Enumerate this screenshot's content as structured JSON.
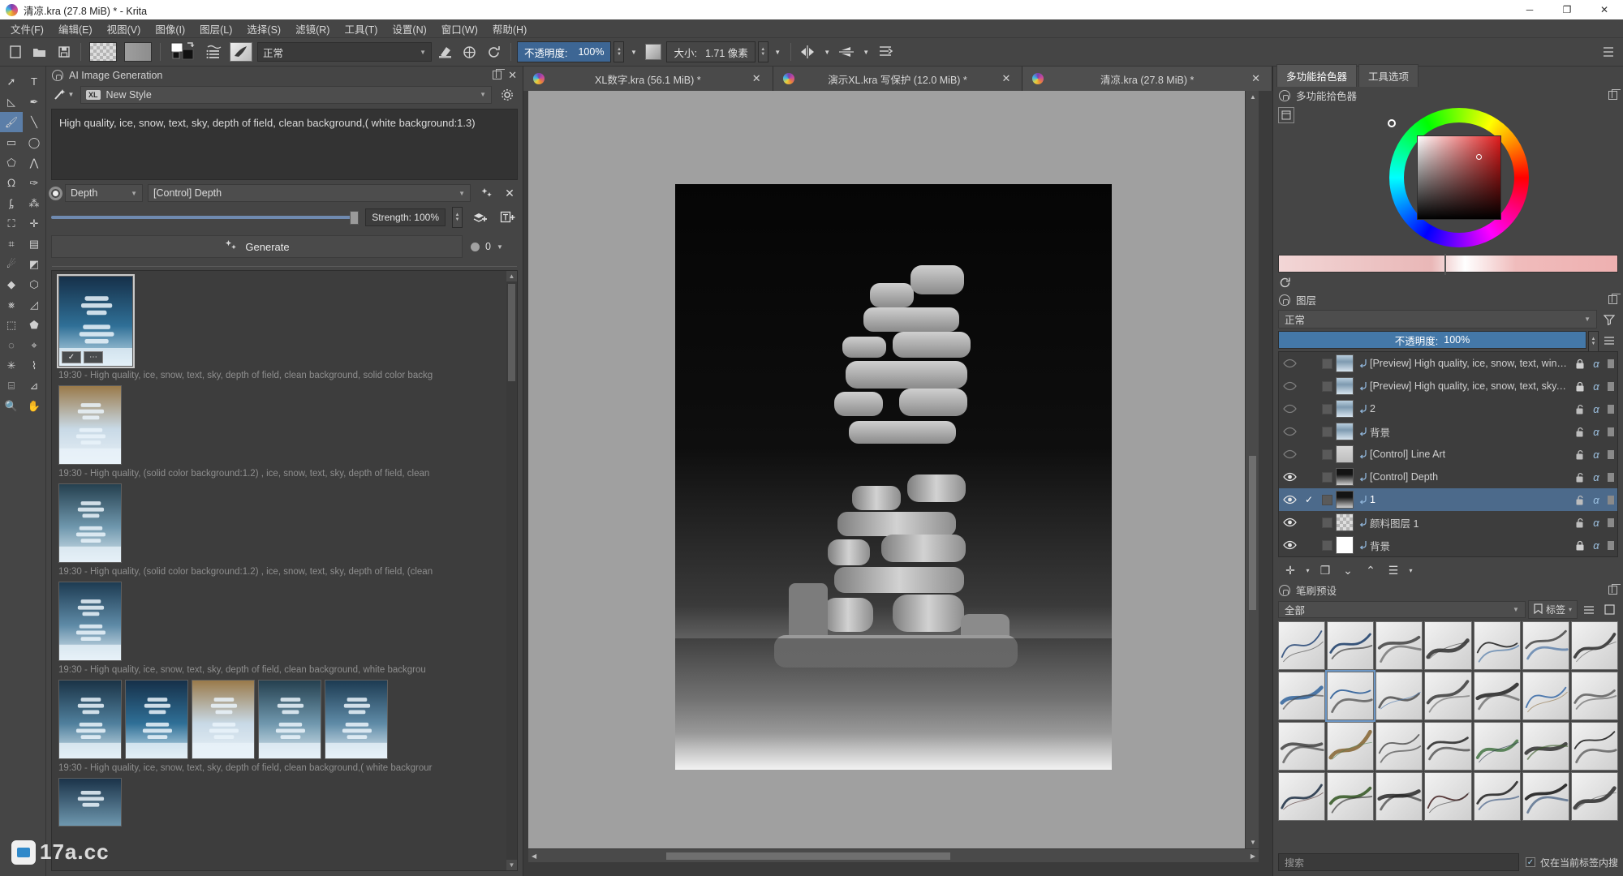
{
  "window": {
    "title": "清凉.kra (27.8 MiB) * - Krita",
    "minimize": "─",
    "maximize": "❐",
    "close": "✕"
  },
  "menu": {
    "items": [
      "文件(F)",
      "编辑(E)",
      "视图(V)",
      "图像(I)",
      "图层(L)",
      "选择(S)",
      "滤镜(R)",
      "工具(T)",
      "设置(N)",
      "窗口(W)",
      "帮助(H)"
    ]
  },
  "toolbar": {
    "new_icon": "new-file-icon",
    "open_icon": "open-folder-icon",
    "save_icon": "save-icon",
    "blend_mode": "正常",
    "opacity_label": "不透明度:",
    "opacity_value": "100%",
    "size_label": "大小:",
    "size_value": "1.71 像素",
    "mirror_icon": "mirror-horizontal-icon",
    "gradient_icon": "fill-gradient-icon",
    "wrap_icon": "wrap-around-icon"
  },
  "tools": {
    "items": [
      {
        "name": "select-shapes-tool",
        "glyph": "➚"
      },
      {
        "name": "text-tool",
        "glyph": "T"
      },
      {
        "name": "edit-shapes-tool",
        "glyph": "◺"
      },
      {
        "name": "calligraphy-tool",
        "glyph": "✒"
      },
      {
        "name": "freehand-brush-tool",
        "glyph": "🖌"
      },
      {
        "name": "line-tool",
        "glyph": "╲"
      },
      {
        "name": "rectangle-tool",
        "glyph": "▭"
      },
      {
        "name": "ellipse-tool",
        "glyph": "◯"
      },
      {
        "name": "polygon-tool",
        "glyph": "⬠"
      },
      {
        "name": "polyline-tool",
        "glyph": "⋀"
      },
      {
        "name": "bezier-curve-tool",
        "glyph": "ᘯ"
      },
      {
        "name": "freehand-path-tool",
        "glyph": "✑"
      },
      {
        "name": "dynamic-brush-tool",
        "glyph": "ᶋ"
      },
      {
        "name": "multibrush-tool",
        "glyph": "⁂"
      },
      {
        "name": "transform-tool",
        "glyph": "⛶"
      },
      {
        "name": "move-tool",
        "glyph": "✛"
      },
      {
        "name": "crop-tool",
        "glyph": "⌗"
      },
      {
        "name": "gradient-tool",
        "glyph": "▤"
      },
      {
        "name": "color-sampler-tool",
        "glyph": "☄"
      },
      {
        "name": "colorize-mask-tool",
        "glyph": "◩"
      },
      {
        "name": "fill-tool",
        "glyph": "◆"
      },
      {
        "name": "smart-patch-tool",
        "glyph": "⬡"
      },
      {
        "name": "assistant-tool",
        "glyph": "⨳"
      },
      {
        "name": "measure-tool",
        "glyph": "◿"
      },
      {
        "name": "rect-select-tool",
        "glyph": "⬚"
      },
      {
        "name": "polygon-select-tool",
        "glyph": "⬟"
      },
      {
        "name": "freehand-select-tool",
        "glyph": "◌"
      },
      {
        "name": "contiguous-select-tool",
        "glyph": "⌖"
      },
      {
        "name": "similar-color-select-tool",
        "glyph": "✳"
      },
      {
        "name": "bezier-select-tool",
        "glyph": "⌇"
      },
      {
        "name": "magnetic-select-tool",
        "glyph": "⌸"
      },
      {
        "name": "enclose-fill-tool",
        "glyph": "⊿"
      },
      {
        "name": "zoom-tool",
        "glyph": "🔍"
      },
      {
        "name": "pan-tool",
        "glyph": "✋"
      }
    ],
    "selected_index": 4
  },
  "ai_docker": {
    "title": "AI Image Generation",
    "style_value": "New Style",
    "style_badge": "XL",
    "wand_icon": "magic-wand-icon",
    "gear_icon": "gear-icon",
    "prompt": "High quality, ice, snow, text, sky, depth of field, clean background,( white background:1.3)",
    "control_type": "Depth",
    "control_layer": "[Control] Depth",
    "strength_label": "Strength: 100%",
    "generate_label": "Generate",
    "generate_icon": "sparkles-icon",
    "seed_value": "0",
    "add_layer_icon": "add-layer-icon",
    "add_text_icon": "add-text-icon",
    "close_icon": "✕",
    "results": [
      {
        "caption": "19:30 - High quality, ice, snow, text, sky, depth of field, clean background, solid color backg",
        "selected": true,
        "badges": [
          "✓",
          "⋯"
        ],
        "variants": 1
      },
      {
        "caption": "19:30 - High quality, (solid color background:1.2) , ice, snow, text, sky, depth of field, clean",
        "selected": false,
        "badges": [],
        "variants": 1
      },
      {
        "caption": "19:30 - High quality, (solid color background:1.2) , ice, snow, text, sky, depth of field, (clean",
        "selected": false,
        "badges": [],
        "variants": 1
      },
      {
        "caption": "19:30 - High quality, ice, snow, text, sky, depth of field, clean background, white backgrou",
        "selected": false,
        "badges": [],
        "variants": 1
      },
      {
        "caption": "19:30 - High quality, ice, snow, text, sky, depth of field, clean background,( white backgrour",
        "selected": false,
        "badges": [],
        "variants": 5
      }
    ]
  },
  "canvas_tabs": [
    {
      "label": "XL数字.kra (56.1 MiB) *",
      "active": false,
      "close": "✕"
    },
    {
      "label": "演示XL.kra 写保护 (12.0 MiB) *",
      "active": false,
      "close": "✕"
    },
    {
      "label": "清凉.kra (27.8 MiB) *",
      "active": true,
      "close": "✕"
    }
  ],
  "right_panel": {
    "tabs": [
      {
        "label": "多功能拾色器",
        "active": true
      },
      {
        "label": "工具选项",
        "active": false
      }
    ],
    "picker_title": "多功能拾色器",
    "refresh_icon": "refresh-icon",
    "float_icon": "float-docker-icon"
  },
  "layers_docker": {
    "title": "图层",
    "blend_mode": "正常",
    "opacity_label": "不透明度:",
    "opacity_value": "100%",
    "filter_icon": "filter-icon",
    "menu_icon": "hamburger-icon",
    "items": [
      {
        "name": "[Preview] High quality, ice, snow, text, winter, depth ...",
        "visible": false,
        "checked": false,
        "locked": true,
        "thumb": "photo",
        "alpha": "α"
      },
      {
        "name": "[Preview] High quality, ice, snow, text, sky, depth of f...",
        "visible": false,
        "checked": false,
        "locked": true,
        "thumb": "photo",
        "alpha": "α"
      },
      {
        "name": "2",
        "visible": false,
        "checked": false,
        "locked": false,
        "thumb": "photo",
        "alpha": "α"
      },
      {
        "name": "背景",
        "visible": false,
        "checked": false,
        "locked": false,
        "thumb": "photo",
        "alpha": "α"
      },
      {
        "name": "[Control] Line Art",
        "visible": false,
        "checked": false,
        "locked": false,
        "thumb": "lineart",
        "alpha": "α"
      },
      {
        "name": "[Control] Depth",
        "visible": true,
        "checked": false,
        "locked": false,
        "thumb": "depth",
        "alpha": "α"
      },
      {
        "name": "1",
        "visible": true,
        "checked": true,
        "locked": false,
        "thumb": "depth",
        "alpha": "α",
        "selected": true
      },
      {
        "name": "颜料图层 1",
        "visible": true,
        "checked": false,
        "locked": false,
        "thumb": "checker",
        "alpha": "α"
      },
      {
        "name": "背景",
        "visible": true,
        "checked": false,
        "locked": true,
        "thumb": "white",
        "alpha": "α"
      }
    ],
    "buttons": [
      {
        "name": "add-layer-button",
        "glyph": "✛"
      },
      {
        "name": "add-layer-dropdown",
        "glyph": "▾"
      },
      {
        "name": "duplicate-layer-button",
        "glyph": "❐"
      },
      {
        "name": "move-layer-down-button",
        "glyph": "⌄"
      },
      {
        "name": "move-layer-up-button",
        "glyph": "⌃"
      },
      {
        "name": "layer-properties-button",
        "glyph": "☰"
      },
      {
        "name": "layer-properties-dropdown",
        "glyph": "▾"
      }
    ]
  },
  "brush_docker": {
    "title": "笔刷预设",
    "filter_value": "全部",
    "tag_label": "标签",
    "tag_icon": "tag-icon",
    "menu_icon": "hamburger-icon",
    "search_placeholder": "搜索",
    "checkbox_label": "仅在当前标签内搜",
    "checkbox_checked": "✓",
    "selected_index": 8,
    "rows": 4,
    "cols": 7
  },
  "colors": {
    "accent_blue": "#4478a8",
    "selection_blue": "#4c6a8b",
    "panel_bg": "#454545",
    "canvas_bg": "#a0a0a0",
    "titlebar_bg": "#ffffff"
  },
  "watermark": "17a.cc"
}
